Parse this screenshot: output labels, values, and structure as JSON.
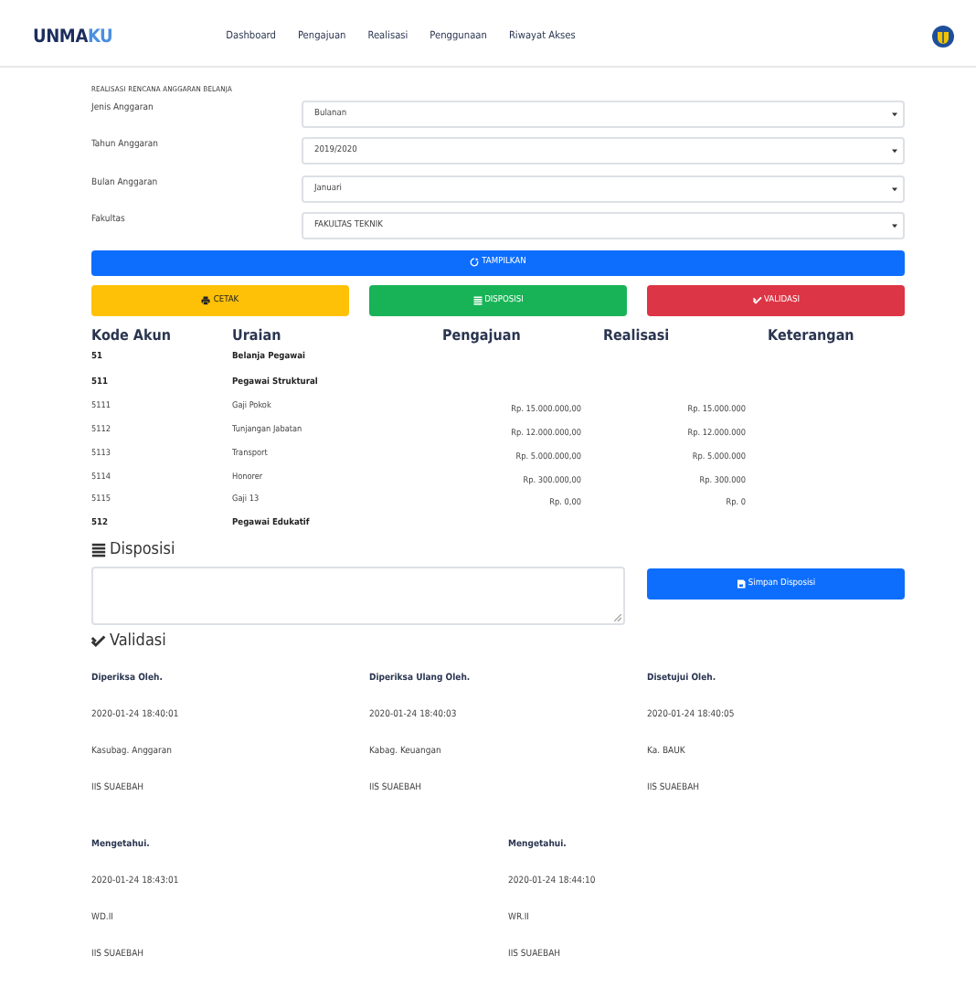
{
  "navbar": {
    "brand": {
      "main": "UNMA",
      "accent": "KU"
    },
    "links": [
      {
        "label": "Dashboard"
      },
      {
        "label": "Pengajuan"
      },
      {
        "label": "Realisasi"
      },
      {
        "label": "Penggunaan"
      },
      {
        "label": "Riwayat Akses"
      }
    ]
  },
  "filter": {
    "title": "REALISASI RENCANA ANGGARAN BELANJA",
    "fields": [
      {
        "label": "Jenis Anggaran",
        "value": "Bulanan"
      },
      {
        "label": "Tahun Anggaran",
        "value": "2019/2020"
      },
      {
        "label": "Bulan Anggaran",
        "value": "Januari"
      },
      {
        "label": "Fakultas",
        "value": "FAKULTAS TEKNIK"
      }
    ],
    "submit": "TAMPILKAN",
    "actions": [
      {
        "label": "CETAK",
        "kind": "print"
      },
      {
        "label": "DISPOSISI",
        "kind": "list"
      },
      {
        "label": "VALIDASI",
        "kind": "check"
      }
    ]
  },
  "table": {
    "columns": [
      "Kode Akun",
      "Uraian",
      "Pengajuan",
      "Realisasi",
      "Keterangan"
    ],
    "rows": [
      {
        "kind": "group",
        "code": "51",
        "name": "Belanja Pegawai"
      },
      {
        "kind": "group",
        "code": "511",
        "name": "Pegawai Struktural"
      },
      {
        "kind": "item",
        "code": "5111",
        "name": "Gaji Pokok",
        "pengajuan": "Rp. 15.000.000,00",
        "realisasi": "Rp. 15.000.000"
      },
      {
        "kind": "item",
        "code": "5112",
        "name": "Tunjangan Jabatan",
        "pengajuan": "Rp. 12.000.000,00",
        "realisasi": "Rp. 12.000.000"
      },
      {
        "kind": "item",
        "code": "5113",
        "name": "Transport",
        "pengajuan": "Rp. 5.000.000,00",
        "realisasi": "Rp. 5.000.000"
      },
      {
        "kind": "item",
        "code": "5114",
        "name": "Honorer",
        "pengajuan": "Rp. 300.000,00",
        "realisasi": "Rp. 300.000"
      },
      {
        "kind": "item",
        "code": "5115",
        "name": "Gaji 13",
        "pengajuan": "Rp. 0,00",
        "realisasi": "Rp. 0"
      },
      {
        "kind": "group",
        "code": "512",
        "name": "Pegawai Edukatif"
      }
    ]
  },
  "disposisi": {
    "title": "Disposisi",
    "button": "Simpan Disposisi"
  },
  "validasi": {
    "title": "Validasi",
    "signers": [
      {
        "role": "Diperiksa Oleh.",
        "time": "2020-01-24 18:40:01",
        "position": "Kasubag. Anggaran",
        "name": "IIS SUAEBAH"
      },
      {
        "role": "Diperiksa Ulang Oleh.",
        "time": "2020-01-24 18:40:03",
        "position": "Kabag. Keuangan",
        "name": "IIS SUAEBAH"
      },
      {
        "role": "Disetujui Oleh.",
        "time": "2020-01-24 18:40:05",
        "position": "Ka. BAUK",
        "name": "IIS SUAEBAH"
      }
    ],
    "witnesses": [
      {
        "role": "Mengetahui.",
        "time": "2020-01-24 18:43:01",
        "position": "WD.II",
        "name": "IIS SUAEBAH"
      },
      {
        "role": "Mengetahui.",
        "time": "2020-01-24 18:44:10",
        "position": "WR.II",
        "name": "IIS SUAEBAH"
      }
    ]
  }
}
